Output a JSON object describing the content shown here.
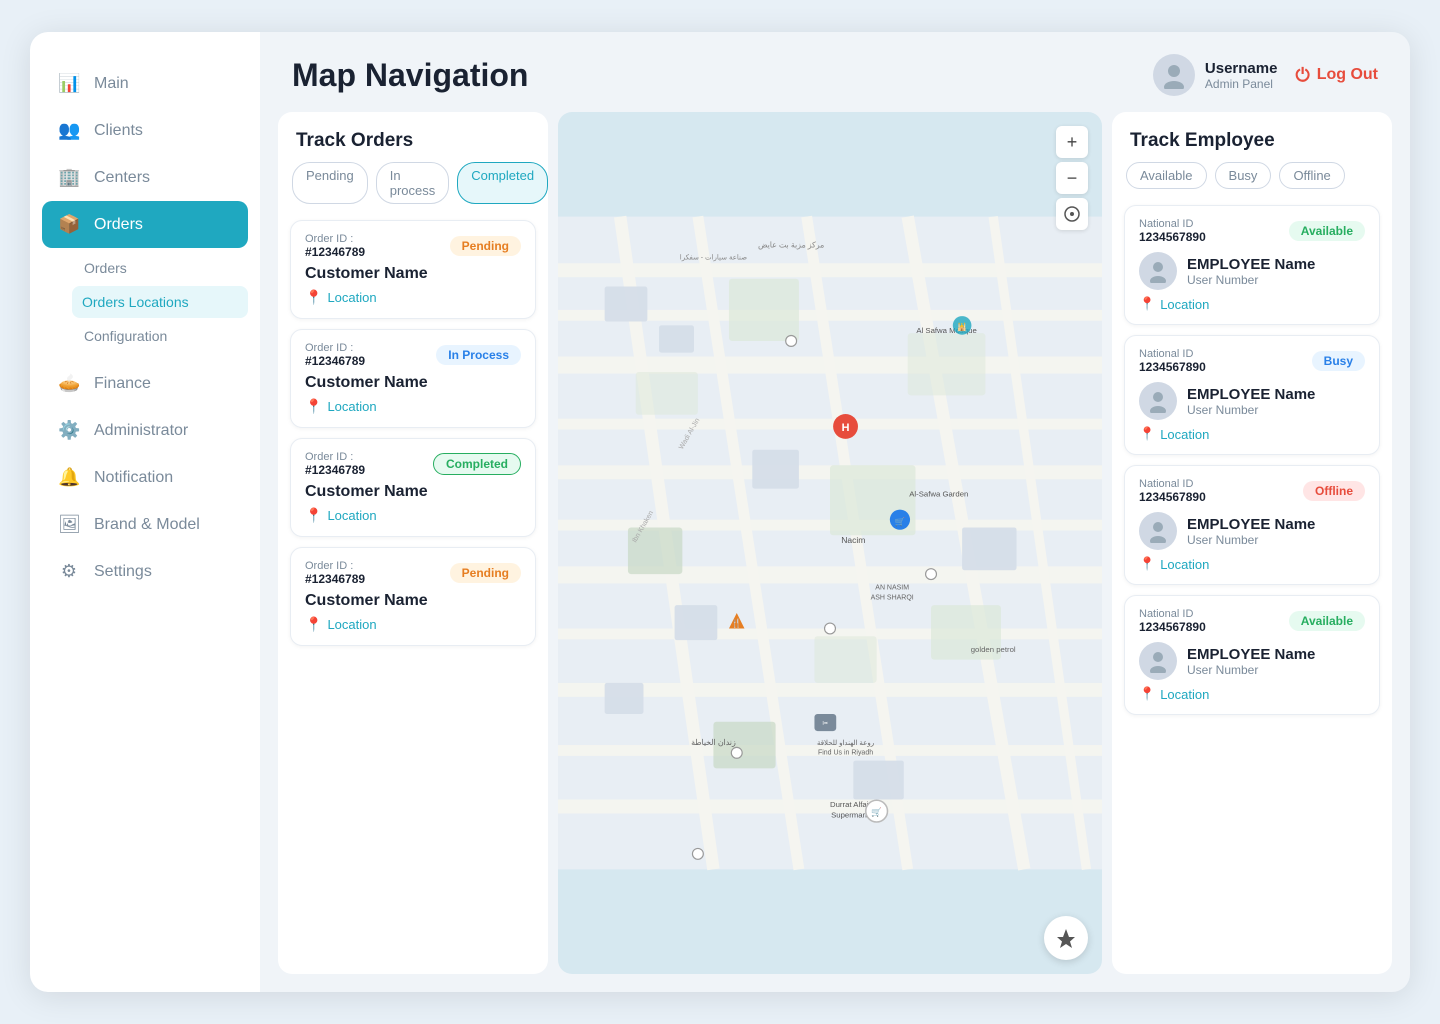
{
  "app": {
    "title": "Map Navigation"
  },
  "sidebar": {
    "items": [
      {
        "id": "main",
        "label": "Main",
        "icon": "📊"
      },
      {
        "id": "clients",
        "label": "Clients",
        "icon": "👥"
      },
      {
        "id": "centers",
        "label": "Centers",
        "icon": "🏢"
      },
      {
        "id": "orders",
        "label": "Orders",
        "icon": "📦",
        "active": true
      },
      {
        "id": "finance",
        "label": "Finance",
        "icon": "🥧"
      },
      {
        "id": "administrator",
        "label": "Administrator",
        "icon": "⚙️"
      },
      {
        "id": "notification",
        "label": "Notification",
        "icon": "🔔"
      },
      {
        "id": "brand_model",
        "label": "Brand & Model",
        "icon": "🖼"
      },
      {
        "id": "settings",
        "label": "Settings",
        "icon": "⚙"
      }
    ],
    "subnav": [
      {
        "id": "orders_sub",
        "label": "Orders"
      },
      {
        "id": "orders_locations",
        "label": "Orders Locations",
        "active": true
      },
      {
        "id": "configuration",
        "label": "Configuration"
      }
    ]
  },
  "header": {
    "user": {
      "name": "Username",
      "role": "Admin Panel"
    },
    "logout_label": "Log Out"
  },
  "track_orders": {
    "title": "Track Orders",
    "filters": [
      {
        "id": "pending",
        "label": "Pending"
      },
      {
        "id": "in_process",
        "label": "In process"
      },
      {
        "id": "completed",
        "label": "Completed"
      }
    ],
    "orders": [
      {
        "order_id_label": "Order ID :",
        "order_id_value": "#12346789",
        "status": "Pending",
        "status_class": "badge-pending",
        "customer_label": "Customer Name",
        "location_label": "Location"
      },
      {
        "order_id_label": "Order ID :",
        "order_id_value": "#12346789",
        "status": "In Process",
        "status_class": "badge-inprocess",
        "customer_label": "Customer Name",
        "location_label": "Location"
      },
      {
        "order_id_label": "Order ID :",
        "order_id_value": "#12346789",
        "status": "Completed",
        "status_class": "badge-completed",
        "customer_label": "Customer Name",
        "location_label": "Location"
      },
      {
        "order_id_label": "Order ID :",
        "order_id_value": "#12346789",
        "status": "Pending",
        "status_class": "badge-pending",
        "customer_label": "Customer Name",
        "location_label": "Location"
      }
    ]
  },
  "track_employee": {
    "title": "Track Employee",
    "filters": [
      {
        "id": "available",
        "label": "Available"
      },
      {
        "id": "busy",
        "label": "Busy"
      },
      {
        "id": "offline",
        "label": "Offline"
      }
    ],
    "employees": [
      {
        "national_id_label": "National ID",
        "national_id_value": "1234567890",
        "status": "Available",
        "status_class": "emp-status-available",
        "name": "EMPLOYEE Name",
        "user_number": "User Number",
        "location_label": "Location"
      },
      {
        "national_id_label": "National ID",
        "national_id_value": "1234567890",
        "status": "Busy",
        "status_class": "emp-status-busy",
        "name": "EMPLOYEE Name",
        "user_number": "User Number",
        "location_label": "Location"
      },
      {
        "national_id_label": "National ID",
        "national_id_value": "1234567890",
        "status": "Offline",
        "status_class": "emp-status-offline",
        "name": "EMPLOYEE Name",
        "user_number": "User Number",
        "location_label": "Location"
      },
      {
        "national_id_label": "National ID",
        "national_id_value": "1234567890",
        "status": "Available",
        "status_class": "emp-status-available",
        "name": "EMPLOYEE Name",
        "user_number": "User Number",
        "location_label": "Location"
      }
    ]
  },
  "map": {
    "zoom_in": "+",
    "zoom_out": "−",
    "locate": "➤"
  }
}
